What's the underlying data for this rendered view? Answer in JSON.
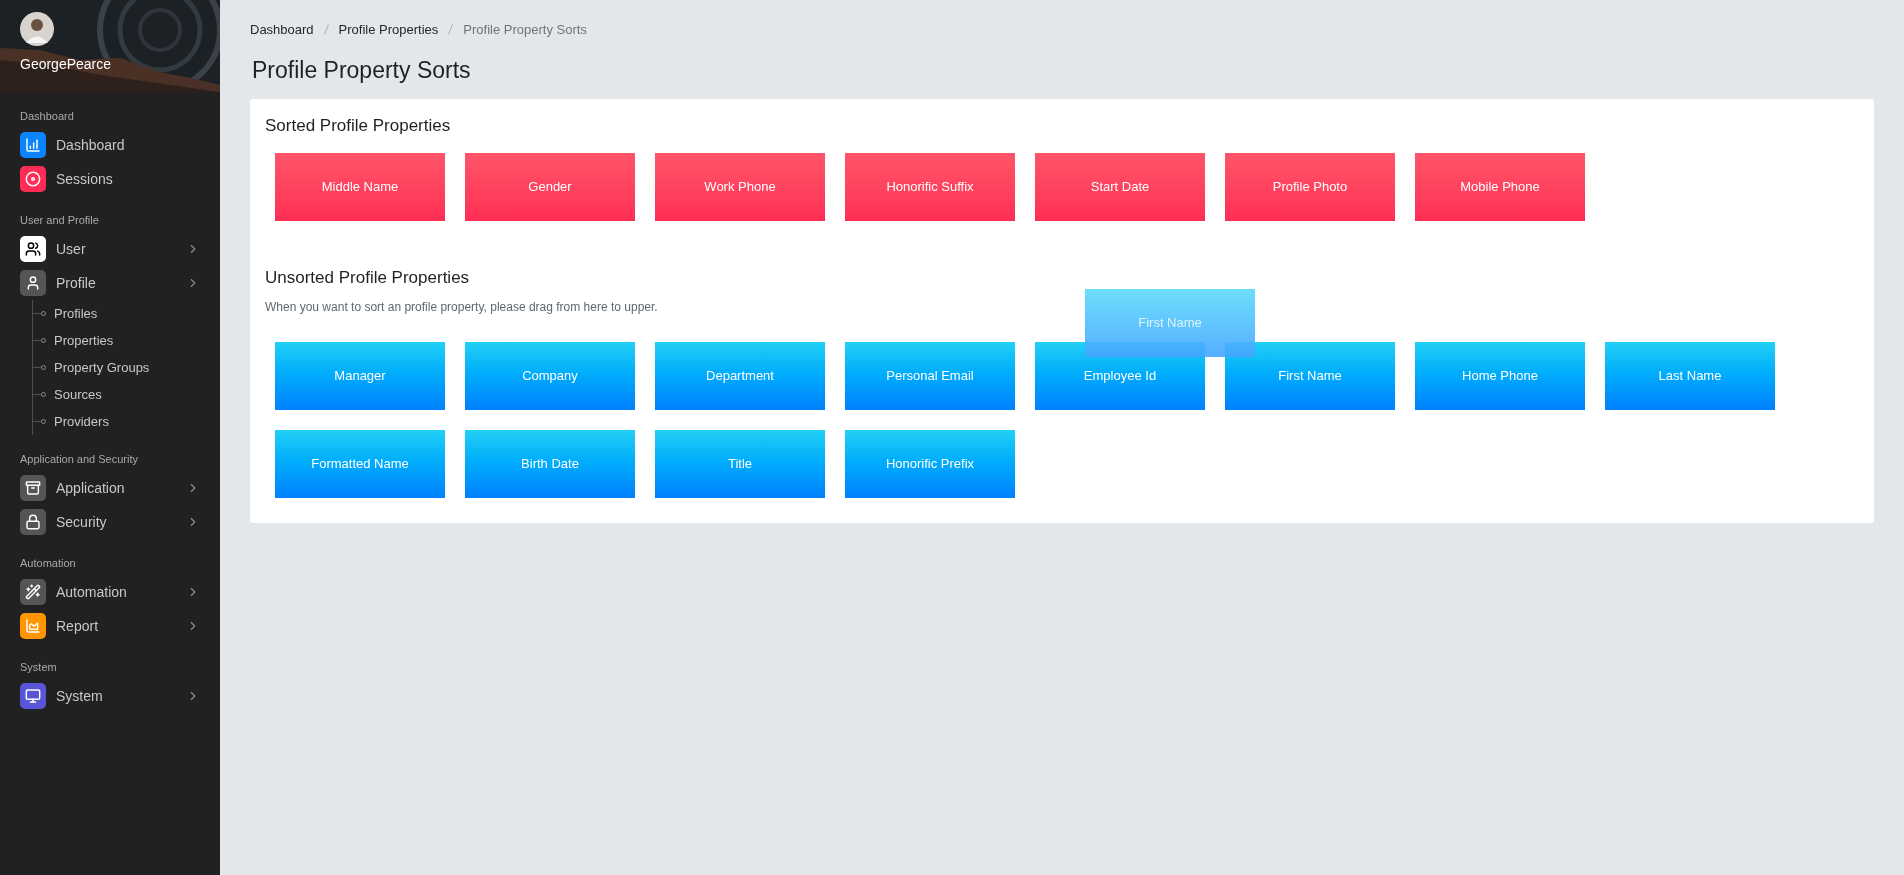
{
  "sidebar": {
    "user": {
      "name": "GeorgePearce"
    },
    "sections": [
      {
        "label": "Dashboard",
        "items": [
          {
            "label": "Dashboard",
            "color": "#0a84ff"
          },
          {
            "label": "Sessions",
            "color": "#ff2d55"
          }
        ]
      },
      {
        "label": "User and Profile",
        "items": [
          {
            "label": "User",
            "color": "#ffffff",
            "submenu": true
          },
          {
            "label": "Profile",
            "color": "#555555",
            "submenu": true,
            "children": [
              {
                "label": "Profiles"
              },
              {
                "label": "Properties"
              },
              {
                "label": "Property Groups"
              },
              {
                "label": "Sources"
              },
              {
                "label": "Providers"
              }
            ]
          }
        ]
      },
      {
        "label": "Application and Security",
        "items": [
          {
            "label": "Application",
            "color": "#555555",
            "submenu": true
          },
          {
            "label": "Security",
            "color": "#555555",
            "submenu": true
          }
        ]
      },
      {
        "label": "Automation",
        "items": [
          {
            "label": "Automation",
            "color": "#555555",
            "submenu": true
          },
          {
            "label": "Report",
            "color": "#ff9500",
            "submenu": true
          }
        ]
      },
      {
        "label": "System",
        "items": [
          {
            "label": "System",
            "color": "#5856d6",
            "submenu": true
          }
        ]
      }
    ]
  },
  "breadcrumb": [
    {
      "label": "Dashboard",
      "current": false
    },
    {
      "label": "Profile Properties",
      "current": false
    },
    {
      "label": "Profile Property Sorts",
      "current": true
    }
  ],
  "page_title": "Profile Property Sorts",
  "sorted": {
    "title": "Sorted Profile Properties",
    "items": [
      "Middle Name",
      "Gender",
      "Work Phone",
      "Honorific Suffix",
      "Start Date",
      "Profile Photo",
      "Mobile Phone"
    ]
  },
  "unsorted": {
    "title": "Unsorted Profile Properties",
    "description": "When you want to sort an profile property, please drag from here to upper.",
    "items": [
      "Manager",
      "Company",
      "Department",
      "Personal Email",
      "Employee Id",
      "First Name",
      "Home Phone",
      "Last Name",
      "Formatted Name",
      "Birth Date",
      "Title",
      "Honorific Prefix"
    ]
  },
  "drag_ghost": {
    "label": "First Name"
  }
}
